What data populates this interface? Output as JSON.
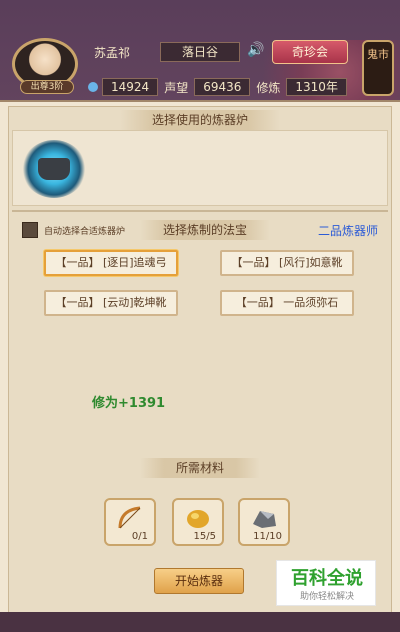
{
  "player": {
    "name": "苏孟祁",
    "rank": "出尊3阶",
    "location": "落日谷"
  },
  "top": {
    "event_button": "奇珍会",
    "market_button": "鬼市"
  },
  "stats": {
    "spirit_stones": "14924",
    "reputation_label": "声望",
    "reputation": "69436",
    "cultivation_label": "修炼",
    "cultivation": "1310年"
  },
  "sections": {
    "furnace_title": "选择使用的炼器炉",
    "treasure_title": "选择炼制的法宝",
    "materials_title": "所需材料"
  },
  "auto_select_label": "自动选择合适炼器炉",
  "grade": "二品炼器师",
  "items": [
    {
      "label": "【一品】 [逐日]追魂弓"
    },
    {
      "label": "【一品】 [风行]如意靴"
    },
    {
      "label": "【一品】 [云动]乾坤靴"
    },
    {
      "label": "【一品】 一品须弥石"
    }
  ],
  "cultivation_gain": "修为+1391",
  "materials": [
    {
      "icon": "bow-icon",
      "count": "0/1"
    },
    {
      "icon": "gold-ore-icon",
      "count": "15/5"
    },
    {
      "icon": "iron-ore-icon",
      "count": "11/10"
    }
  ],
  "start_button": "开始炼器",
  "watermark": {
    "title": "百科全说",
    "subtitle": "助你轻松解决"
  },
  "colors": {
    "accent": "#e0a24a",
    "grade": "#2c5bd6",
    "gain": "#2f8a2f"
  }
}
